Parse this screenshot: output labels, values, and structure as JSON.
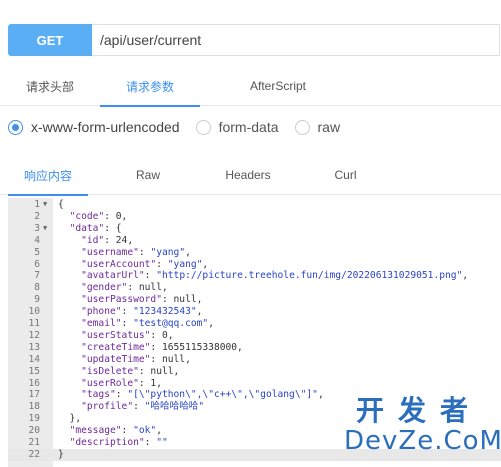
{
  "request": {
    "method": "GET",
    "url": "/api/user/current"
  },
  "request_tabs": [
    {
      "label": "请求头部",
      "active": false
    },
    {
      "label": "请求参数",
      "active": true
    },
    {
      "label": "AfterScript",
      "active": false
    }
  ],
  "body_types": [
    {
      "label": "x-www-form-urlencoded",
      "checked": true
    },
    {
      "label": "form-data",
      "checked": false
    },
    {
      "label": "raw",
      "checked": false
    }
  ],
  "response_tabs": [
    {
      "label": "响应内容",
      "active": true
    },
    {
      "label": "Raw",
      "active": false
    },
    {
      "label": "Headers",
      "active": false
    },
    {
      "label": "Curl",
      "active": false
    }
  ],
  "code_lines": [
    "{",
    "  \"code\": 0,",
    "  \"data\": {",
    "    \"id\": 24,",
    "    \"username\": \"yang\",",
    "    \"userAccount\": \"yang\",",
    "    \"avatarUrl\": \"http://picture.treehole.fun/img/202206131029051.png\",",
    "    \"gender\": null,",
    "    \"userPassword\": null,",
    "    \"phone\": \"123432543\",",
    "    \"email\": \"test@qq.com\",",
    "    \"userStatus\": 0,",
    "    \"createTime\": 1655115338000,",
    "    \"updateTime\": null,",
    "    \"isDelete\": null,",
    "    \"userRole\": 1,",
    "    \"tags\": \"[\\\"python\\\",\\\"c++\\\",\\\"golang\\\"]\",",
    "    \"profile\": \"哈哈哈哈哈\"",
    "  },",
    "  \"message\": \"ok\",",
    "  \"description\": \"\"",
    "}"
  ],
  "line_numbers": [
    "1",
    "2",
    "3",
    "4",
    "5",
    "6",
    "7",
    "8",
    "9",
    "10",
    "11",
    "12",
    "13",
    "14",
    "15",
    "16",
    "17",
    "18",
    "19",
    "20",
    "21",
    "22"
  ],
  "fold_markers": {
    "1": "▼",
    "3": "▼"
  },
  "active_line": 22,
  "watermark": {
    "top": "开发者",
    "bottom": "DevZe.CoM"
  },
  "colors": {
    "accent": "#3d8ff0",
    "method_bg": "#5aaef4",
    "watermark": "#2b6fbc"
  }
}
